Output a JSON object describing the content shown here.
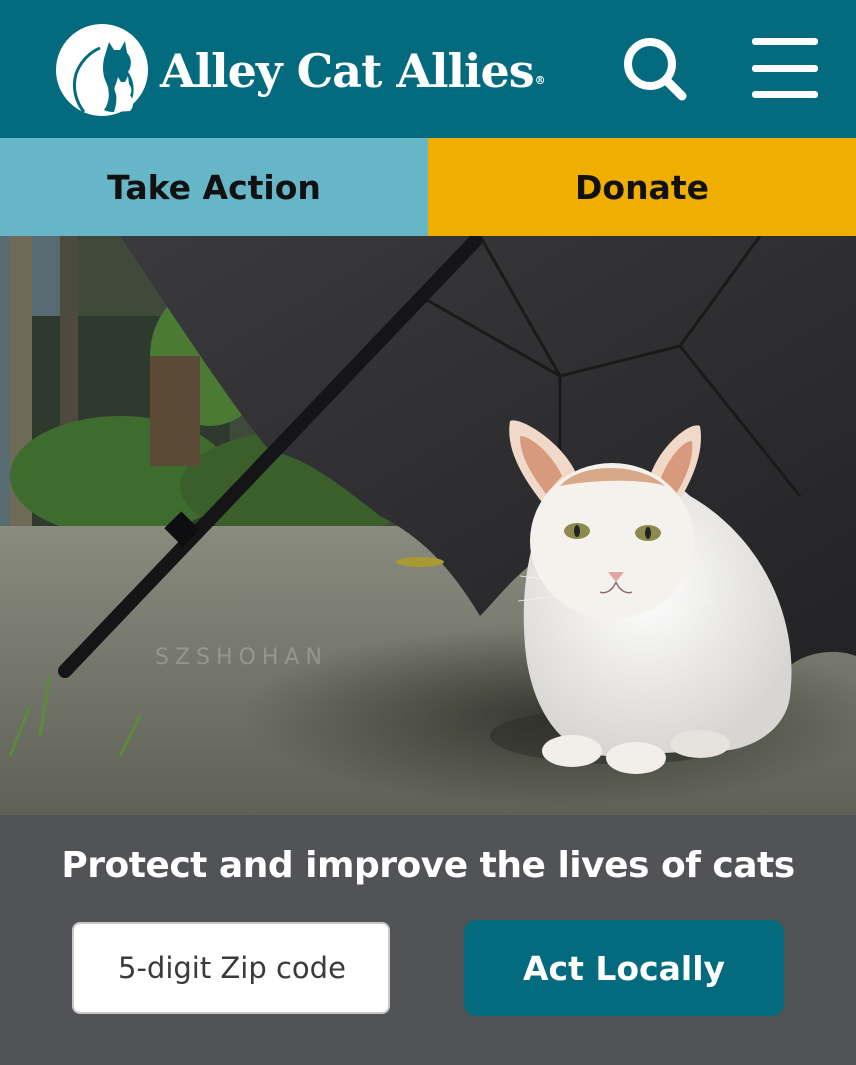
{
  "header": {
    "brand": "Alley Cat Allies",
    "registered_mark": "®",
    "logo_icon": "cat-silhouette-logo-icon",
    "search_icon": "search-icon",
    "menu_icon": "hamburger-menu-icon"
  },
  "cta": {
    "take_action": "Take Action",
    "donate": "Donate"
  },
  "hero": {
    "watermark": "SZSHOHAN"
  },
  "panel": {
    "tagline": "Protect and improve the lives of cats",
    "zip_placeholder": "5-digit Zip code",
    "act_button": "Act Locally"
  },
  "colors": {
    "header_bg": "#046b7f",
    "take_action_bg": "#67b6c7",
    "donate_bg": "#f0ae00",
    "panel_bg": "#525357",
    "act_button_bg": "#046b7f"
  }
}
